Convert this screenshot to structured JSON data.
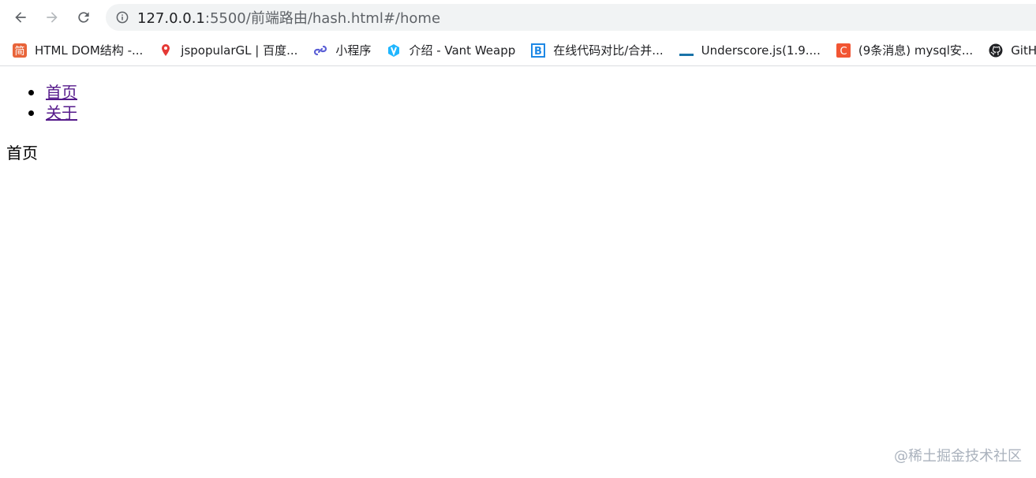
{
  "browser": {
    "url_host": "127.0.0.1",
    "url_rest": ":5500/前端路由/hash.html#/home",
    "bookmarks": [
      {
        "label": "HTML DOM结构 -...",
        "icon": "jian-badge-icon",
        "color": "#e8643a"
      },
      {
        "label": "jspopularGL | 百度...",
        "icon": "map-pin-icon",
        "color": "#e53935"
      },
      {
        "label": "小程序",
        "icon": "miniprogram-link-icon",
        "color": "#5b5fd6"
      },
      {
        "label": "介绍 - Vant Weapp",
        "icon": "vant-icon",
        "color": "#1fb6ff"
      },
      {
        "label": "在线代码对比/合并...",
        "icon": "b-bracket-icon",
        "color": "#1e88e5"
      },
      {
        "label": "Underscore.js(1.9....",
        "icon": "underscore-icon",
        "color": "#1a73a8"
      },
      {
        "label": "(9条消息) mysql安...",
        "icon": "csdn-c-icon",
        "color": "#f25533"
      },
      {
        "label": "GitHu",
        "icon": "github-icon",
        "color": "#202124"
      }
    ]
  },
  "page": {
    "nav": [
      {
        "label": "首页",
        "href": "#/home"
      },
      {
        "label": "关于",
        "href": "#/about"
      }
    ],
    "view_text": "首页"
  },
  "watermark": "@稀土掘金技术社区"
}
